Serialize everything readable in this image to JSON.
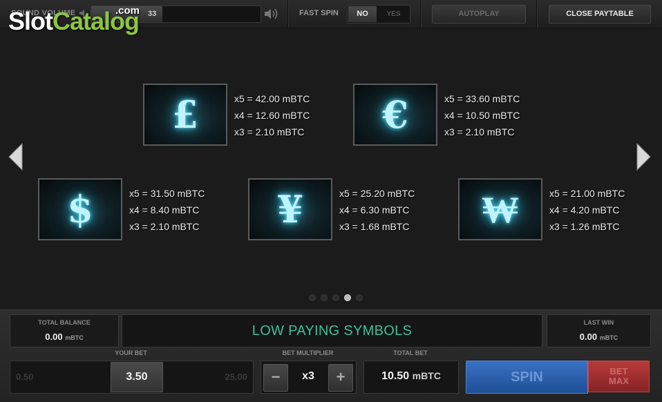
{
  "topbar": {
    "sound_volume_label": "SOUND VOLUME",
    "volume_value": "33",
    "volume_fraction": 0.42,
    "fast_spin_label": "FAST SPIN",
    "fast_spin_no": "NO",
    "fast_spin_yes": "YES",
    "autoplay_label": "AUTOPLAY",
    "close_paytable_label": "CLOSE PAYTABLE"
  },
  "logo": {
    "slot": "Slot",
    "catalog": "Catalog",
    "com": ".com"
  },
  "paytable": {
    "symbols": [
      {
        "icon": "pound-icon",
        "glyph": "£",
        "pays": [
          "x5 = 42.00 mBTC",
          "x4 = 12.60 mBTC",
          "x3 = 2.10 mBTC"
        ]
      },
      {
        "icon": "euro-icon",
        "glyph": "€",
        "pays": [
          "x5 = 33.60 mBTC",
          "x4 = 10.50 mBTC",
          "x3 = 2.10 mBTC"
        ]
      },
      {
        "icon": "dollar-icon",
        "glyph": "$",
        "pays": [
          "x5 = 31.50 mBTC",
          "x4 = 8.40 mBTC",
          "x3 = 2.10 mBTC"
        ]
      },
      {
        "icon": "yen-icon",
        "glyph": "¥",
        "pays": [
          "x5 = 25.20 mBTC",
          "x4 = 6.30 mBTC",
          "x3 = 1.68 mBTC"
        ]
      },
      {
        "icon": "won-icon",
        "glyph": "₩",
        "pays": [
          "x5 = 21.00 mBTC",
          "x4 = 4.20 mBTC",
          "x3 = 1.26 mBTC"
        ]
      }
    ],
    "page_count": 5,
    "active_page": 4
  },
  "bottom": {
    "total_balance_label": "TOTAL BALANCE",
    "total_balance_value": "0.00",
    "unit": "mBTC",
    "banner": "LOW PAYING SYMBOLS",
    "last_win_label": "LAST WIN",
    "last_win_value": "0.00",
    "your_bet_label": "YOUR BET",
    "bet_min": "0.50",
    "bet_value": "3.50",
    "bet_max": "25.00",
    "bet_multiplier_label": "BET MULTIPLIER",
    "minus": "−",
    "plus": "+",
    "multiplier_value": "x3",
    "total_bet_label": "TOTAL BET",
    "total_bet_value": "10.50",
    "total_bet_unit": "mBTC",
    "spin_label": "SPIN",
    "bet_max_line1": "BET",
    "bet_max_line2": "MAX"
  }
}
